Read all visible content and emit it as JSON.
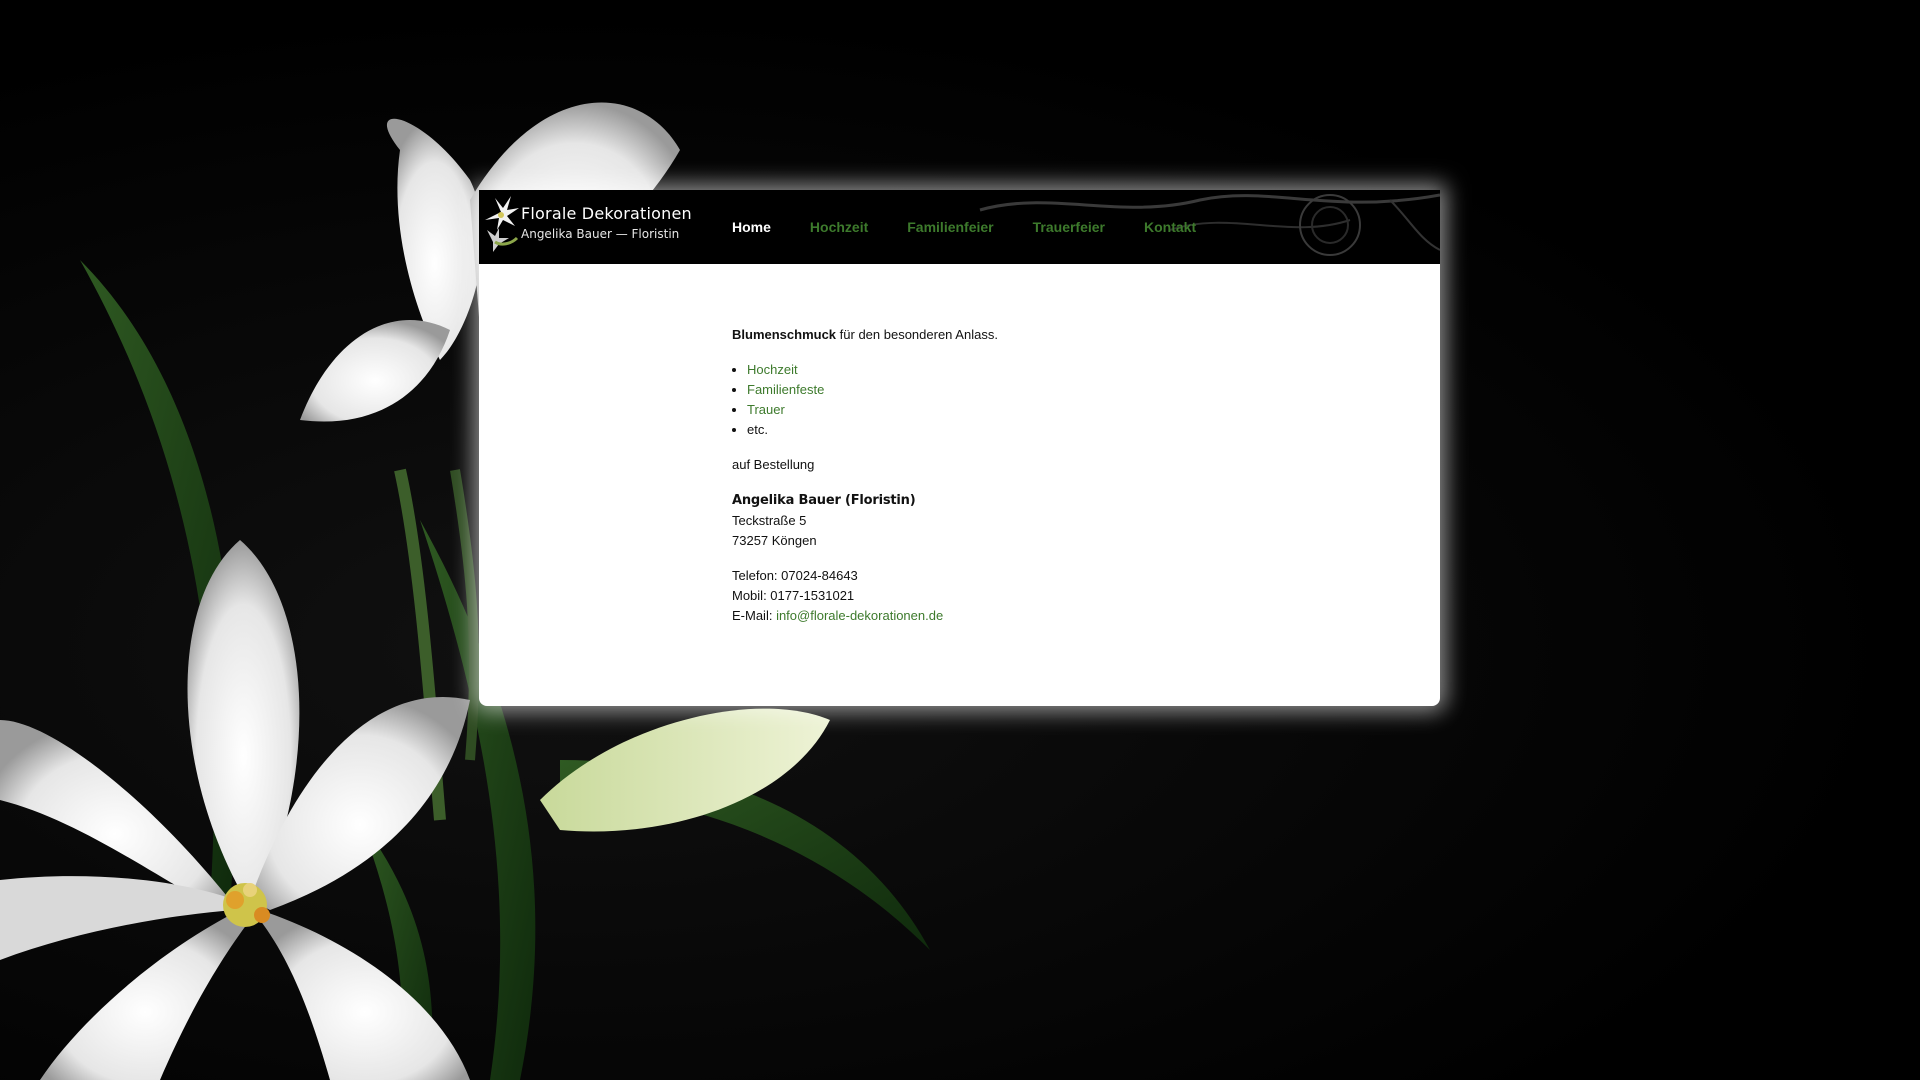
{
  "site": {
    "logo_title": "Florale Dekorationen",
    "logo_subtitle": "Angelika Bauer — Floristin"
  },
  "nav": {
    "items": [
      {
        "label": "Home",
        "active": true
      },
      {
        "label": "Hochzeit",
        "active": false
      },
      {
        "label": "Familienfeier",
        "active": false
      },
      {
        "label": "Trauerfeier",
        "active": false
      },
      {
        "label": "Kontakt",
        "active": false
      }
    ]
  },
  "content": {
    "intro_bold": "Blumenschmuck",
    "intro_rest": " für den besonderen Anlass.",
    "list": [
      {
        "label": "Hochzeit",
        "link": true
      },
      {
        "label": "Familienfeste",
        "link": true
      },
      {
        "label": "Trauer",
        "link": true
      },
      {
        "label": "etc.",
        "link": false
      }
    ],
    "order_note": "auf Bestellung",
    "contact_name": "Angelika Bauer (Floristin)",
    "street": "Teckstraße 5",
    "city": "73257 Köngen",
    "phone_label": "Telefon: ",
    "phone": "07024-84643",
    "mobile_label": "Mobil: ",
    "mobile": "0177-1531021",
    "email_label": "E-Mail: ",
    "email": "info@florale-dekorationen.de"
  },
  "colors": {
    "link_green": "#3d7a2c",
    "background": "#000000",
    "panel": "#ffffff"
  }
}
